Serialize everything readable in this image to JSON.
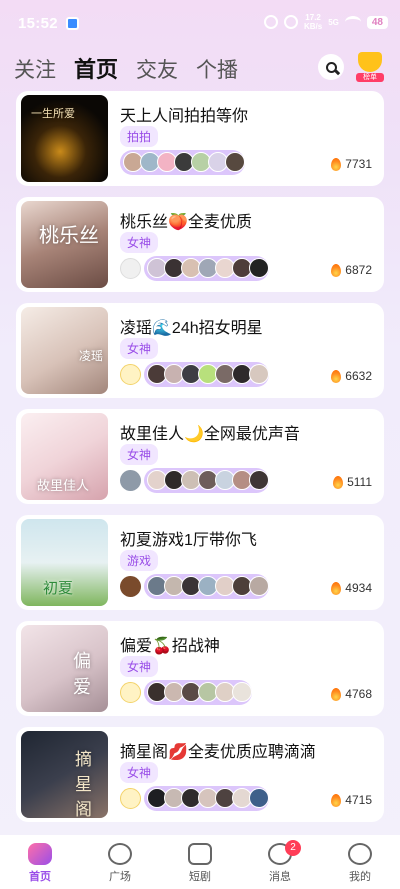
{
  "status_bar": {
    "time": "15:52",
    "speed_top": "17.2",
    "speed_unit": "KB/s",
    "network": "5G",
    "battery": "48"
  },
  "top_tabs": [
    {
      "label": "关注",
      "active": false
    },
    {
      "label": "首页",
      "active": true
    },
    {
      "label": "交友",
      "active": false
    },
    {
      "label": "个播",
      "active": false
    }
  ],
  "header_icons": {
    "search": "search-icon",
    "rank": "trophy-icon",
    "rank_label": "榜单"
  },
  "rooms": [
    {
      "title": "天上人间拍拍等你",
      "tag": "拍拍",
      "heat": "7731",
      "cover_text": "一生所爱",
      "host_avatar": false,
      "member_count": 7
    },
    {
      "title": "桃乐丝🍑全麦优质",
      "tag": "女神",
      "heat": "6872",
      "cover_text": "桃乐丝",
      "host_avatar": true,
      "member_count": 7
    },
    {
      "title": "凌瑶🌊24h招女明星",
      "tag": "女神",
      "heat": "6632",
      "cover_text": "凌瑶",
      "host_avatar": true,
      "member_count": 7
    },
    {
      "title": "故里佳人🌙全网最优声音",
      "tag": "女神",
      "heat": "5111",
      "cover_text": "故里佳人",
      "host_avatar": true,
      "member_count": 7
    },
    {
      "title": "初夏游戏1厅带你飞",
      "tag": "游戏",
      "heat": "4934",
      "cover_text": "初夏",
      "host_avatar": true,
      "member_count": 7
    },
    {
      "title": "偏爱🍒招战神",
      "tag": "女神",
      "heat": "4768",
      "cover_text": "偏爱",
      "host_avatar": true,
      "member_count": 6
    },
    {
      "title": "摘星阁💋全麦优质应聘滴滴",
      "tag": "女神",
      "heat": "4715",
      "cover_text": "摘星阁",
      "host_avatar": true,
      "member_count": 7
    }
  ],
  "bottom_nav": [
    {
      "label": "首页",
      "icon": "home-icon",
      "active": true
    },
    {
      "label": "广场",
      "icon": "plaza-icon",
      "active": false
    },
    {
      "label": "短剧",
      "icon": "play-icon",
      "active": false
    },
    {
      "label": "消息",
      "icon": "message-icon",
      "active": false,
      "badge": "2"
    },
    {
      "label": "我的",
      "icon": "profile-icon",
      "active": false
    }
  ],
  "colors": {
    "accent": "#9a4ee8",
    "tag_bg": "#f1e6ff",
    "badge": "#ff3d57",
    "heat_flame": "#ff8a1f"
  }
}
